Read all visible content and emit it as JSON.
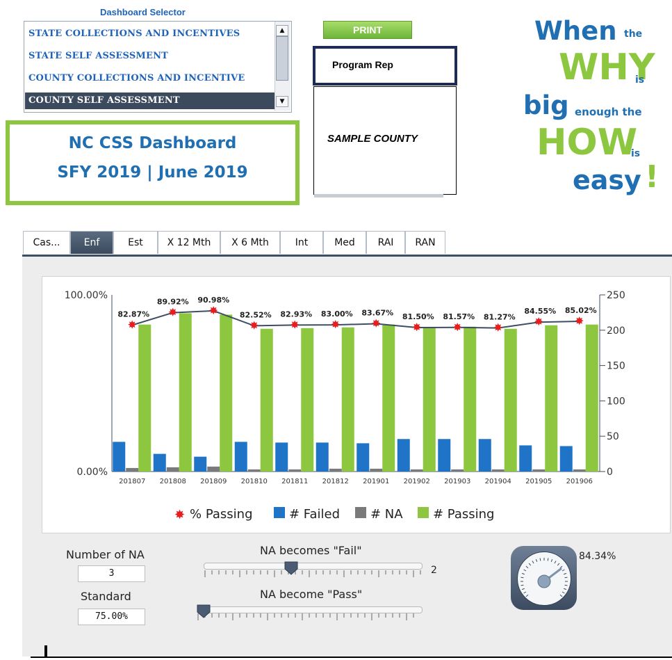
{
  "selector": {
    "title": "Dashboard Selector",
    "items": [
      {
        "label": "STATE COLLECTIONS AND INCENTIVES",
        "selected": false
      },
      {
        "label": "STATE SELF ASSESSMENT",
        "selected": false
      },
      {
        "label": "COUNTY COLLECTIONS AND INCENTIVE",
        "selected": false
      },
      {
        "label": "COUNTY SELF ASSESSMENT",
        "selected": true
      }
    ]
  },
  "header": {
    "title_line1": "NC CSS Dashboard",
    "title_line2": "SFY 2019 | June 2019",
    "print_label": "PRINT",
    "program_rep": "Program Rep",
    "county": "SAMPLE COUNTY"
  },
  "slogan": {
    "when": "When",
    "the1": "the",
    "why": "WHY",
    "is1": "is",
    "big": "big",
    "enough_the": "enough the",
    "how": "HOW",
    "is2": "is",
    "easy": "easy",
    "bang": "!"
  },
  "tabs": [
    {
      "label": "Cas...",
      "active": false
    },
    {
      "label": "Enf",
      "active": true
    },
    {
      "label": "Est",
      "active": false
    },
    {
      "label": "X 12 Mth",
      "active": false
    },
    {
      "label": "X 6 Mth",
      "active": false
    },
    {
      "label": "Int",
      "active": false
    },
    {
      "label": "Med",
      "active": false
    },
    {
      "label": "RAI",
      "active": false
    },
    {
      "label": "RAN",
      "active": false
    }
  ],
  "colors": {
    "passing": "#8dc63f",
    "failed": "#1f74c8",
    "na": "#7a7a7a",
    "pct": "#e81e1e",
    "line": "#3d4d63"
  },
  "chart_data": {
    "type": "bar",
    "categories": [
      "201807",
      "201808",
      "201809",
      "201810",
      "201811",
      "201812",
      "201901",
      "201902",
      "201903",
      "201904",
      "201905",
      "201906"
    ],
    "series": [
      {
        "name": "# Failed",
        "axis": "right",
        "values": [
          42,
          25,
          21,
          42,
          41,
          41,
          40,
          46,
          46,
          46,
          37,
          36
        ]
      },
      {
        "name": "# NA",
        "axis": "right",
        "values": [
          5,
          6,
          7,
          3,
          3,
          4,
          4,
          3,
          3,
          3,
          3,
          3
        ]
      },
      {
        "name": "# Passing",
        "axis": "right",
        "values": [
          208,
          224,
          222,
          202,
          203,
          204,
          208,
          204,
          205,
          202,
          207,
          208
        ]
      },
      {
        "name": "% Passing",
        "axis": "left",
        "type": "scatter-line",
        "values": [
          82.87,
          89.92,
          90.98,
          82.52,
          82.93,
          83.0,
          83.67,
          81.5,
          81.57,
          81.27,
          84.55,
          85.02
        ],
        "labels": [
          "82.87%",
          "89.92%",
          "90.98%",
          "82.52%",
          "82.93%",
          "83.00%",
          "83.67%",
          "81.50%",
          "81.57%",
          "81.27%",
          "84.55%",
          "85.02%"
        ]
      }
    ],
    "left_axis": {
      "ticks": [
        "100.00%",
        "0.00%"
      ],
      "ylim": [
        0,
        100
      ]
    },
    "right_axis": {
      "ticks": [
        "250",
        "200",
        "150",
        "100",
        "50",
        "0"
      ],
      "ylim": [
        0,
        250
      ]
    },
    "legend": [
      "% Passing",
      "# Failed",
      "# NA",
      "# Passing"
    ],
    "legend_position": "bottom"
  },
  "controls": {
    "na_label": "Number of NA",
    "na_value": "3",
    "standard_label": "Standard",
    "standard_value": "75.00%",
    "fail_slider_label": "NA becomes \"Fail\"",
    "fail_slider_value": "2",
    "pass_slider_label": "NA become \"Pass\"",
    "gauge_value": "84.34%"
  }
}
